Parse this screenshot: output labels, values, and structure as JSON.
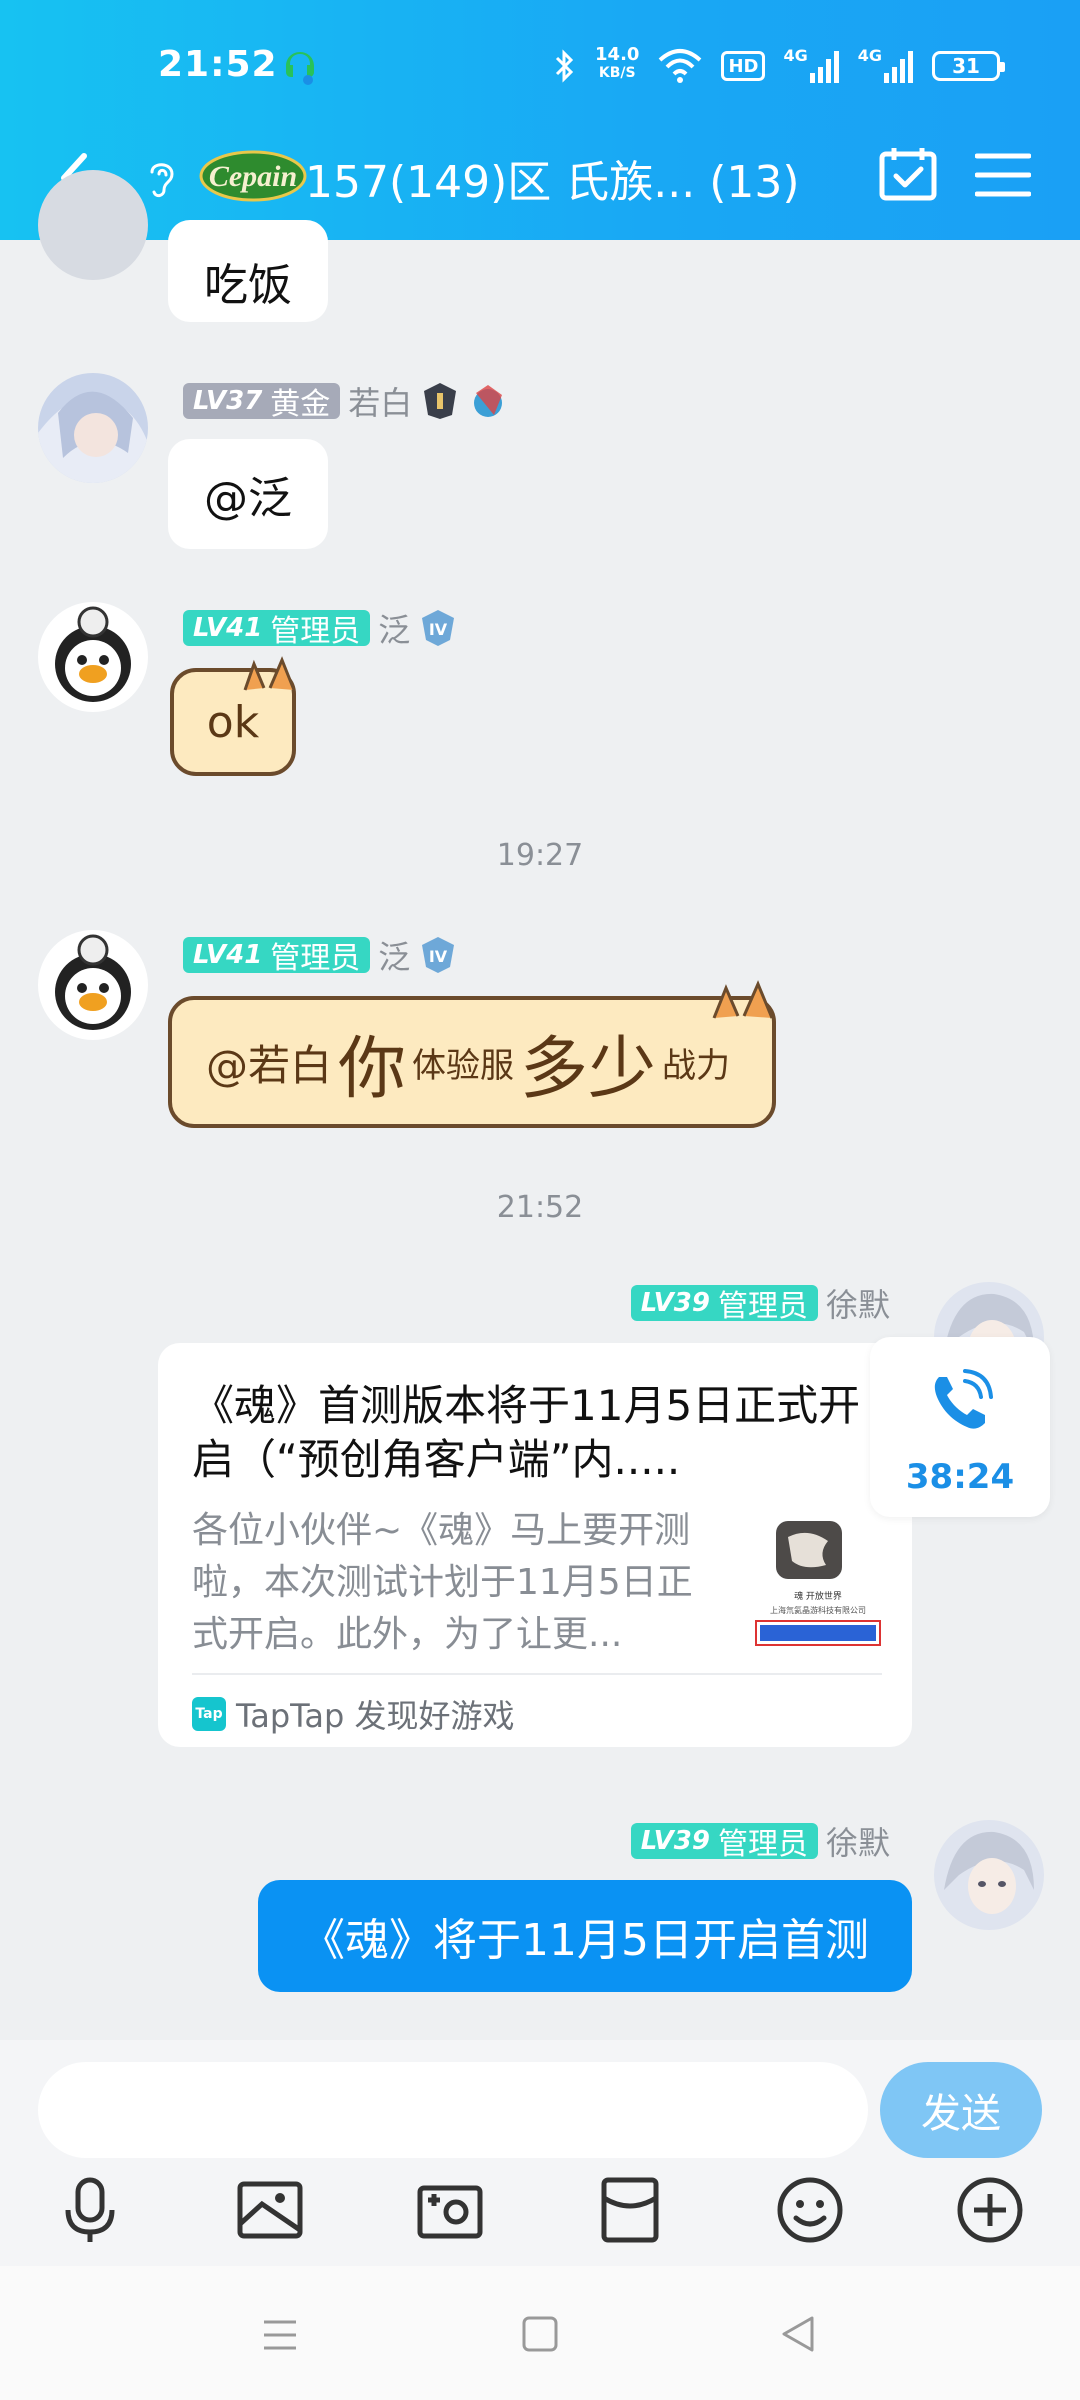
{
  "status_bar": {
    "time": "21:52",
    "net_speed_value": "14.0",
    "net_speed_unit": "KB/S",
    "hd_label": "HD",
    "network_1": "4G",
    "network_2": "4G",
    "battery": "31"
  },
  "header": {
    "group_title": "157(149)区 氏族... (13)",
    "logo_text": "Cepain"
  },
  "messages": [
    {
      "text": "吃饭"
    },
    {
      "level": "LV37",
      "rank": "黄金",
      "name": "若白",
      "text": "@泛"
    },
    {
      "level": "LV41",
      "rank": "管理员",
      "name": "泛",
      "text": "ok"
    },
    {
      "time": "19:27"
    },
    {
      "level": "LV41",
      "rank": "管理员",
      "name": "泛",
      "parts": [
        "@若白 ",
        "你",
        "体验服",
        "多少",
        "战力"
      ]
    },
    {
      "time": "21:52"
    },
    {
      "level": "LV39",
      "rank": "管理员",
      "name": "徐默"
    },
    {
      "level": "LV39",
      "rank": "管理员",
      "name": "徐默",
      "text": "《魂》将于11月5日开启首测"
    }
  ],
  "link_card": {
    "title": "《魂》首测版本将于11月5日正式开启（“预创角客户端”内.....",
    "description": "各位小伙伴~《魂》马上要开测啦，本次测试计划于11月5日正式开启。此外，为了让更...",
    "source": "TapTap 发现好游戏",
    "source_icon": "Tap",
    "thumb_caption": "魂 开放世界",
    "thumb_company": "上海氘氦晶游科技有限公司"
  },
  "call": {
    "duration": "38:24"
  },
  "input_bar": {
    "placeholder": "",
    "send_label": "发送"
  },
  "toolbar": [
    "microphone-icon",
    "image-icon",
    "camera-icon",
    "red-packet-icon",
    "emoji-icon",
    "plus-icon"
  ],
  "colors": {
    "header_start": "#17c2f2",
    "header_end": "#1aa0f5",
    "accent_blue": "#0a92f3",
    "admin_tag": "#36d7c3",
    "gold_tag": "#a6aab8"
  }
}
